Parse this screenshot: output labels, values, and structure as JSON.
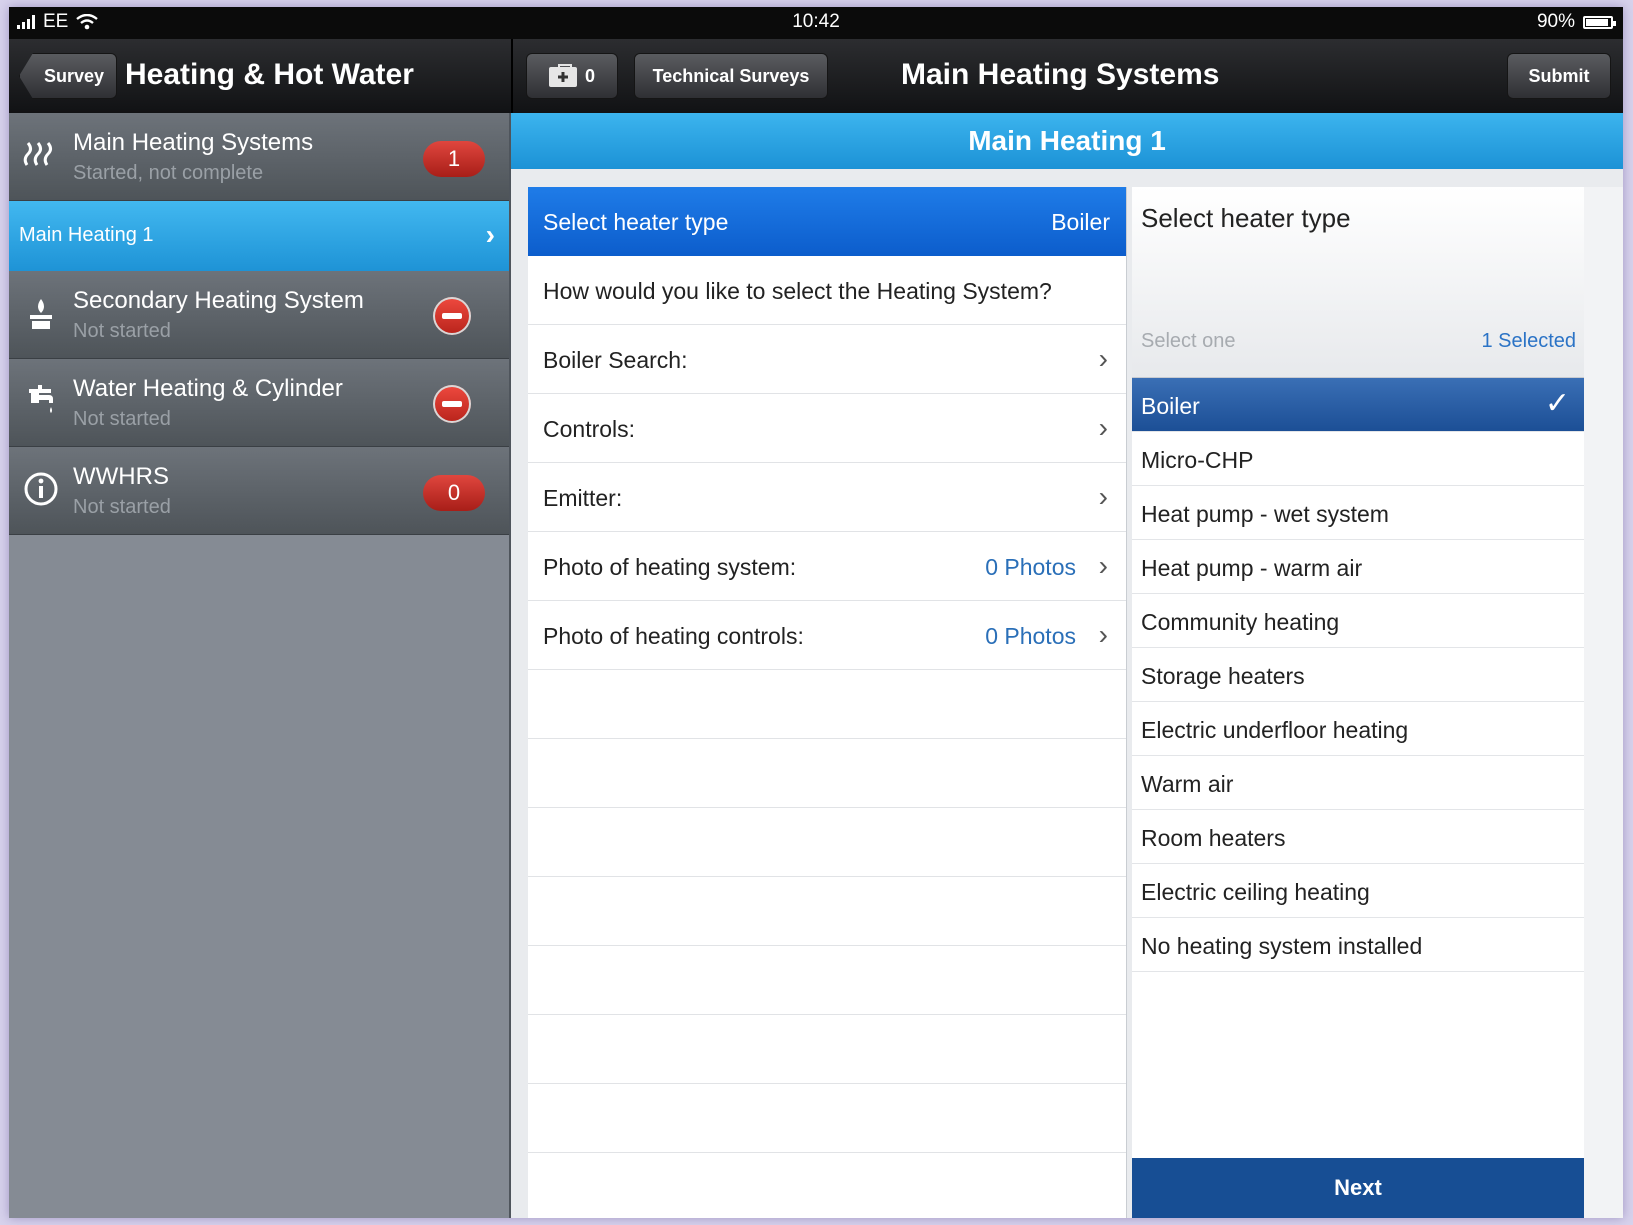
{
  "status_bar": {
    "carrier": "EE",
    "time": "10:42",
    "battery": "90%"
  },
  "nav": {
    "back_label": "Survey",
    "left_title": "Heating & Hot Water",
    "kit_count": "0",
    "technical_surveys_label": "Technical Surveys",
    "main_title": "Main Heating Systems",
    "submit_label": "Submit"
  },
  "sidebar": {
    "items": [
      {
        "title": "Main Heating Systems",
        "subtitle": "Started, not complete",
        "badge": "1",
        "icon": "heat-waves-icon"
      },
      {
        "title": "Secondary Heating System",
        "subtitle": "Not started",
        "icon": "fireplace-icon"
      },
      {
        "title": "Water Heating & Cylinder",
        "subtitle": "Not started",
        "icon": "tap-icon"
      },
      {
        "title": "WWHRS",
        "subtitle": "Not started",
        "badge": "0",
        "icon": "info-icon"
      }
    ],
    "selected_sub_item": "Main Heating 1"
  },
  "section_header": "Main Heating 1",
  "form": {
    "heater_type_label": "Select heater type",
    "heater_type_value": "Boiler",
    "question": "How would you like to select the Heating System?",
    "rows": [
      {
        "label": "Boiler Search:",
        "value": ""
      },
      {
        "label": "Controls:",
        "value": ""
      },
      {
        "label": "Emitter:",
        "value": ""
      },
      {
        "label": "Photo of heating system:",
        "value": "0 Photos"
      },
      {
        "label": "Photo of heating controls:",
        "value": "0 Photos"
      }
    ]
  },
  "picker": {
    "title": "Select heater type",
    "hint": "Select one",
    "selected_count": "1 Selected",
    "options": [
      "Boiler",
      "Micro-CHP",
      "Heat pump - wet system",
      "Heat pump - warm air",
      "Community heating",
      "Storage heaters",
      "Electric underfloor heating",
      "Warm air",
      "Room heaters",
      "Electric ceiling heating",
      "No heating system installed"
    ],
    "selected_option": "Boiler",
    "next_label": "Next"
  },
  "colors": {
    "accent_blue": "#1f7ce8",
    "header_blue": "#2aa3e3",
    "badge_red": "#c8322b",
    "next_blue": "#174e94"
  }
}
